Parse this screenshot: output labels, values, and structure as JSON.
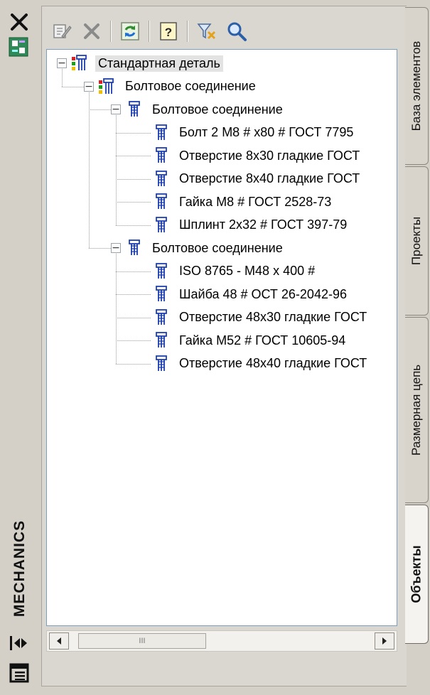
{
  "titlebar": {
    "brand": "MECHANICS",
    "close_icon": "close-icon",
    "properties_icon": "properties-icon",
    "autohide_icon": "autohide-icon",
    "menu_icon": "menu-icon"
  },
  "toolbar": {
    "buttons": [
      {
        "name": "edit-icon"
      },
      {
        "name": "delete-icon"
      },
      {
        "name": "refresh-icon"
      },
      {
        "name": "help-icon"
      },
      {
        "name": "filter-icon"
      },
      {
        "name": "search-icon"
      }
    ]
  },
  "tree": [
    {
      "label": "Стандартная деталь",
      "level": 0,
      "expander": "−",
      "icon": "assembly-color-icon",
      "selected": true
    },
    {
      "label": "Болтовое соединение",
      "level": 1,
      "expander": "−",
      "icon": "assembly-color-icon"
    },
    {
      "label": "Болтовое соединение",
      "level": 2,
      "expander": "−",
      "icon": "part-icon"
    },
    {
      "label": "Болт 2 M8 # x80 # ГОСТ 7795",
      "level": 3,
      "icon": "part-icon"
    },
    {
      "label": "Отверстие 8x30 гладкие ГОСТ",
      "level": 3,
      "icon": "part-icon"
    },
    {
      "label": "Отверстие 8x40 гладкие ГОСТ",
      "level": 3,
      "icon": "part-icon"
    },
    {
      "label": "Гайка M8 # ГОСТ 2528-73",
      "level": 3,
      "icon": "part-icon"
    },
    {
      "label": "Шплинт 2x32 # ГОСТ 397-79",
      "level": 3,
      "icon": "part-icon"
    },
    {
      "label": "Болтовое соединение",
      "level": 2,
      "expander": "−",
      "icon": "part-icon"
    },
    {
      "label": "ISO 8765 - M48 x 400 #",
      "level": 3,
      "icon": "part-icon"
    },
    {
      "label": "Шайба 48 # ОСТ 26-2042-96",
      "level": 3,
      "icon": "part-icon"
    },
    {
      "label": "Отверстие 48x30 гладкие ГОСТ",
      "level": 3,
      "icon": "part-icon"
    },
    {
      "label": "Гайка M52 # ГОСТ 10605-94",
      "level": 3,
      "icon": "part-icon"
    },
    {
      "label": "Отверстие 48x40 гладкие ГОСТ",
      "level": 3,
      "icon": "part-icon"
    }
  ],
  "scrollbar": {
    "left_icon": "scroll-left-icon",
    "right_icon": "scroll-right-icon",
    "thumb_grip": "III"
  },
  "tabs": [
    {
      "label": "База элементов",
      "active": false
    },
    {
      "label": "Проекты",
      "active": false
    },
    {
      "label": "Размерная цепь",
      "active": false
    },
    {
      "label": "Объекты",
      "active": true
    }
  ]
}
